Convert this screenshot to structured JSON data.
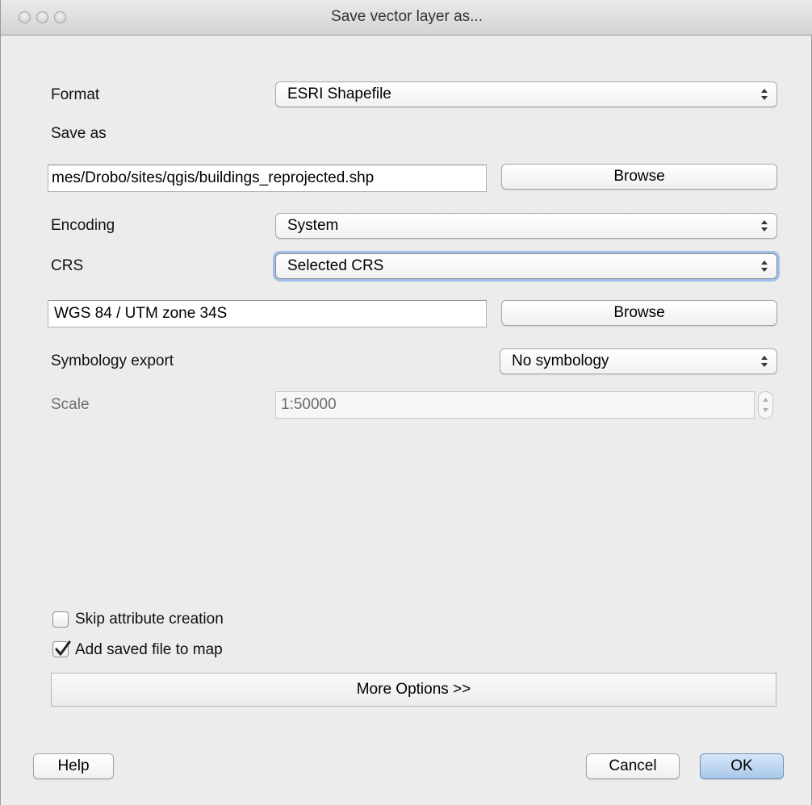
{
  "window": {
    "title": "Save vector layer as..."
  },
  "form": {
    "format_label": "Format",
    "format_value": "ESRI Shapefile",
    "save_as_label": "Save as",
    "save_as_path": "mes/Drobo/sites/qgis/buildings_reprojected.shp",
    "browse_label": "Browse",
    "encoding_label": "Encoding",
    "encoding_value": "System",
    "crs_label": "CRS",
    "crs_value": "Selected CRS",
    "crs_name": "WGS 84 / UTM zone 34S",
    "crs_browse_label": "Browse",
    "symbology_label": "Symbology export",
    "symbology_value": "No symbology",
    "scale_label": "Scale",
    "scale_value": "1:50000"
  },
  "options": {
    "skip_attribute_label": "Skip attribute creation",
    "skip_attribute_checked": false,
    "add_to_map_label": "Add saved file to map",
    "add_to_map_checked": true,
    "more_options_label": "More Options >>"
  },
  "footer": {
    "help_label": "Help",
    "cancel_label": "Cancel",
    "ok_label": "OK"
  },
  "icons": {
    "close": "window-close-icon",
    "minimize": "window-minimize-icon",
    "zoom": "window-zoom-icon",
    "combo_arrows": "updown-arrows-icon",
    "checkmark": "checkmark-icon"
  }
}
